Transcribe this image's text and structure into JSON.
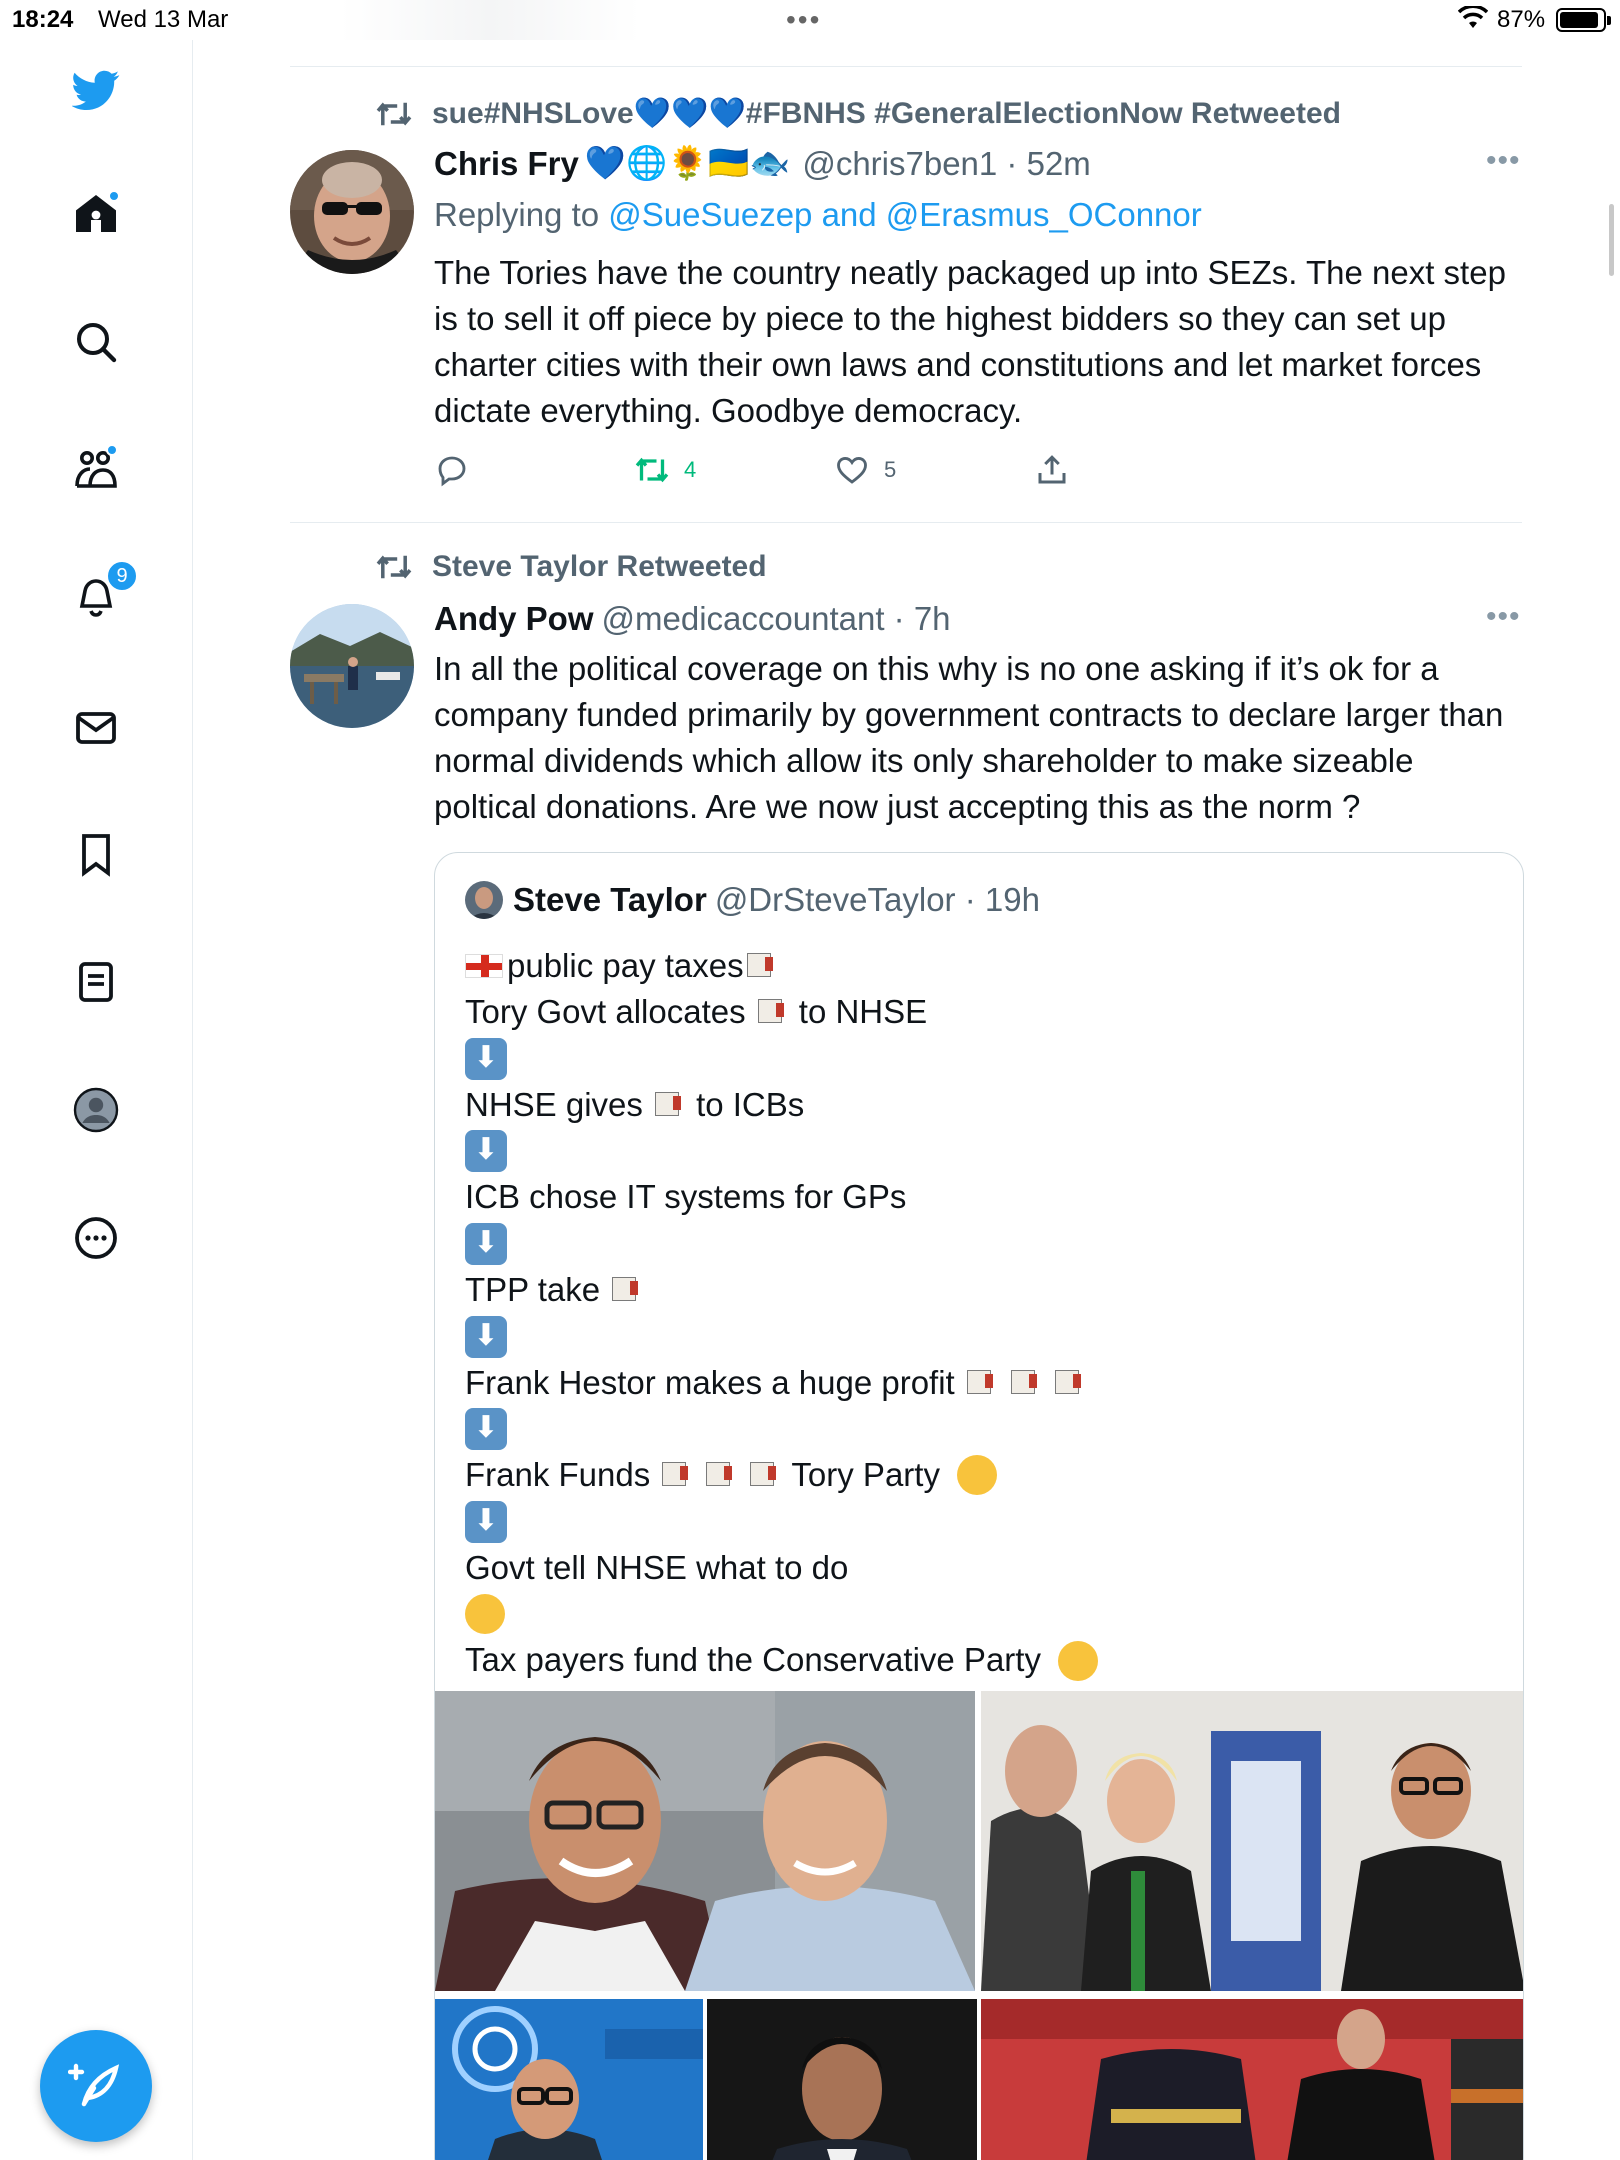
{
  "status_bar": {
    "time": "18:24",
    "date": "Wed 13 Mar",
    "battery": "87%",
    "battery_level": 0.87
  },
  "sidebar": {
    "icons": [
      "twitter-bird-icon",
      "home-icon",
      "search-icon",
      "communities-icon",
      "notifications-icon",
      "messages-icon",
      "bookmarks-icon",
      "lists-icon",
      "profile-icon",
      "more-icon"
    ],
    "notifications_badge": "9",
    "compose": "compose-icon"
  },
  "tweets": [
    {
      "retweeted_by": "sue#NHSLove💙💙💙#FBNHS #GeneralElectionNow Retweeted",
      "name": "Chris Fry",
      "name_emojis": "💙🌐🌻🇺🇦🐟",
      "handle": "@chris7ben1 · 52m",
      "replying_prefix": "Replying to ",
      "replying_to": "@SueSuezep and @Erasmus_OConnor",
      "text": "The Tories have the country neatly packaged up into SEZs. The next step is to sell it off piece by piece to the highest bidders so they can set up charter cities with their own laws and constitutions and let market forces dictate everything. Goodbye democracy.",
      "stats": {
        "retweets": "4",
        "likes": "5"
      }
    },
    {
      "retweeted_by": "Steve Taylor Retweeted",
      "name": "Andy Pow",
      "handle": "@medicaccountant · 7h",
      "text": "In all the political coverage on this why is no one asking if it’s ok for a company funded primarily by government contracts to declare larger than normal dividends which allow its only shareholder to make sizeable poltical donations. Are we now just accepting this as the norm ?",
      "quote": {
        "name": "Steve Taylor",
        "handle": "@DrSteveTaylor · 19h",
        "lines": [
          {
            "pre_flag": true,
            "text": "public pay taxes",
            "money_after": 1
          },
          {
            "text": "Tory Govt allocates ",
            "money_after": 1,
            "tail": "to NHSE"
          },
          {
            "arrow": true
          },
          {
            "text": "NHSE gives ",
            "money_after": 1,
            "tail": "to ICBs"
          },
          {
            "arrow": true
          },
          {
            "text": "ICB chose IT systems for GPs"
          },
          {
            "arrow": true
          },
          {
            "text": "TPP take ",
            "money_after": 1
          },
          {
            "arrow": true
          },
          {
            "text": "Frank Hestor makes a huge profit ",
            "money_after": 3
          },
          {
            "arrow": true
          },
          {
            "text": "Frank Funds ",
            "money_after": 3,
            "tail": "Tory Party ",
            "face": "party-face"
          },
          {
            "arrow": true
          },
          {
            "text": "Govt tell NHSE what to do"
          },
          {
            "face_only": "thinking-face"
          },
          {
            "text": "Tax payers fund the Conservative Party ",
            "face": "flushed-face"
          }
        ],
        "arrow_glyph": "⬇",
        "photos": [
          "photo-two-men-smiling",
          "photo-men-talking-at-event",
          "photo-man-at-podium",
          "photo-man-in-suit",
          "photo-ceremony"
        ]
      }
    }
  ]
}
